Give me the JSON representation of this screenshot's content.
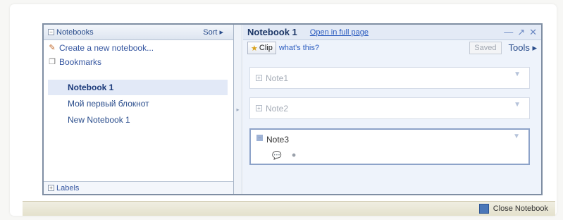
{
  "sidebar": {
    "header_label": "Notebooks",
    "sort_label": "Sort ▸",
    "create_label": "Create a new notebook...",
    "bookmarks_label": "Bookmarks",
    "notebooks": [
      {
        "label": "Notebook 1",
        "active": true
      },
      {
        "label": "Мой первый блокнот",
        "active": false
      },
      {
        "label": "New Notebook 1",
        "active": false
      }
    ],
    "labels_label": "Labels"
  },
  "main": {
    "title": "Notebook 1",
    "open_full_label": "Open in full page",
    "clip_label": "Clip",
    "whats_this_label": "what's this?",
    "saved_label": "Saved",
    "tools_label": "Tools ▸",
    "notes": [
      {
        "label": "Note1"
      },
      {
        "label": "Note2"
      },
      {
        "label": "Note3"
      }
    ]
  },
  "status_bar": {
    "close_label": "Close Notebook"
  }
}
